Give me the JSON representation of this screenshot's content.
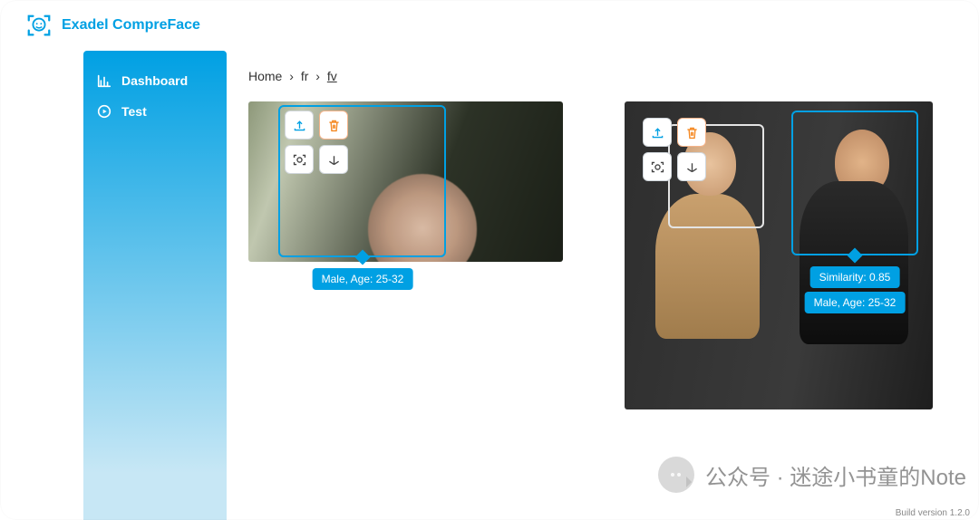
{
  "app": {
    "title": "Exadel CompreFace"
  },
  "sidebar": {
    "items": [
      {
        "label": "Dashboard",
        "icon": "bar-chart-icon"
      },
      {
        "label": "Test",
        "icon": "play-circle-icon"
      }
    ]
  },
  "breadcrumb": {
    "items": [
      "Home",
      "fr",
      "fv"
    ],
    "separator": "›"
  },
  "panels": {
    "left": {
      "face": {
        "label_demographics": "Male, Age: 25-32"
      }
    },
    "right": {
      "faces": [
        {
          "role": "secondary"
        },
        {
          "role": "primary",
          "label_similarity": "Similarity: 0.85",
          "label_demographics": "Male, Age: 25-32"
        }
      ]
    }
  },
  "tools": {
    "upload": "upload-icon",
    "delete": "trash-icon",
    "detect": "face-scan-icon",
    "expand": "axes-icon"
  },
  "footer": {
    "build": "Build version 1.2.0"
  },
  "watermark": {
    "text": "公众号 · 迷途小书童的Note"
  },
  "colors": {
    "accent": "#00a0e3",
    "warn": "#f5871f"
  }
}
